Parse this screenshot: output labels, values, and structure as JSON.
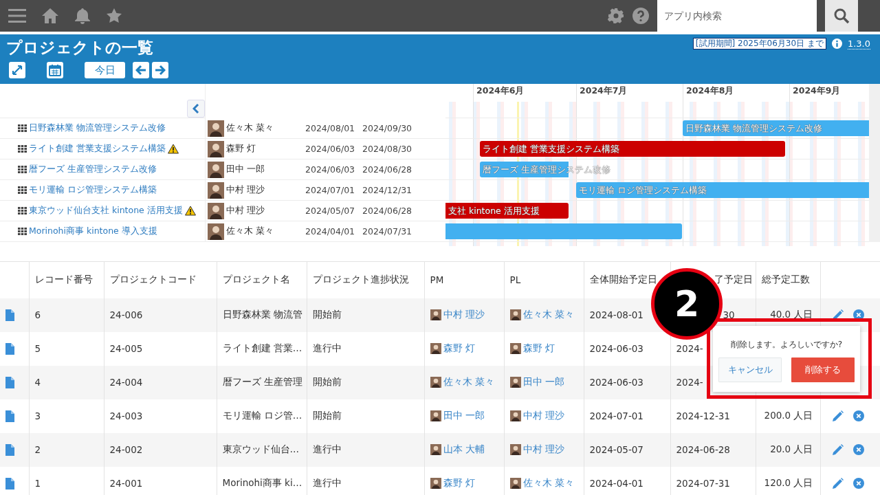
{
  "topbar": {
    "search": {
      "placeholder": "アプリ内検索"
    }
  },
  "header": {
    "title": "プロジェクトの一覧",
    "trial": "[試用期間] 2025年06月30日 まで",
    "version": "1.3.0",
    "today_button": "今日"
  },
  "gantt": {
    "months": [
      "2024年6月",
      "2024年7月",
      "2024年8月",
      "2024年9月"
    ],
    "rows": [
      {
        "name": "日野森林業 物流管理システム改修",
        "warning": false,
        "person": "佐々木 菜々",
        "start": "2024/08/01",
        "end": "2024/09/30",
        "bar": {
          "label": "日野森林業 物流管理システム改修",
          "color": "#42b0f0"
        }
      },
      {
        "name": "ライト創建 営業支援システム構築",
        "warning": true,
        "person": "森野 灯",
        "start": "2024/06/03",
        "end": "2024/08/30",
        "bar": {
          "label": "ライト創建 営業支援システム構築",
          "color": "#cc0000"
        }
      },
      {
        "name": "暦フーズ 生産管理システム改修",
        "warning": false,
        "person": "田中 一郎",
        "start": "2024/06/03",
        "end": "2024/06/28",
        "bar": {
          "label": "暦フーズ 生産管理システム改修",
          "color": "#42b0f0"
        }
      },
      {
        "name": "モリ運輸 ロジ管理システム構築",
        "warning": false,
        "person": "中村 理沙",
        "start": "2024/07/01",
        "end": "2024/12/31",
        "bar": {
          "label": "モリ運輸 ロジ管理システム構築",
          "color": "#42b0f0"
        }
      },
      {
        "name": "東京ウッド仙台支社 kintone 活用支援",
        "warning": true,
        "person": "中村 理沙",
        "start": "2024/05/07",
        "end": "2024/06/28",
        "bar": {
          "label": "支社 kintone 活用支援",
          "color": "#cc0000"
        }
      },
      {
        "name": "Morinohi商事 kintone 導入支援",
        "warning": false,
        "person": "佐々木 菜々",
        "start": "2024/04/01",
        "end": "2024/07/31",
        "bar": {
          "color": "#42b0f0"
        }
      }
    ]
  },
  "table": {
    "columns": [
      "レコード番号",
      "プロジェクトコード",
      "プロジェクト名",
      "プロジェクト進捗状況",
      "PM",
      "PL",
      "全体開始予定日",
      "了予定日",
      "総予定工数"
    ],
    "rows": [
      {
        "no": "6",
        "code": "24-006",
        "name": "日野森林業 物流管",
        "status": "開始前",
        "pm": "中村 理沙",
        "pl": "佐々木 菜々",
        "start": "2024-08-01",
        "end": "30",
        "total": "40.0 人日",
        "actions": true
      },
      {
        "no": "5",
        "code": "24-005",
        "name": "ライト創建 営業…",
        "status": "進行中",
        "pm": "森野 灯",
        "pl": "森野 灯",
        "start": "2024-06-03",
        "end": "2024-",
        "total": "",
        "actions": false
      },
      {
        "no": "4",
        "code": "24-004",
        "name": "暦フーズ 生産管理",
        "status": "開始前",
        "pm": "佐々木 菜々",
        "pl": "田中 一郎",
        "start": "2024-06-03",
        "end": "2024-",
        "total": "",
        "actions": false
      },
      {
        "no": "3",
        "code": "24-003",
        "name": "モリ運輸 ロジ管…",
        "status": "開始前",
        "pm": "田中 一郎",
        "pl": "中村 理沙",
        "start": "2024-07-01",
        "end": "2024-12-31",
        "total": "200.0 人日",
        "actions": true
      },
      {
        "no": "2",
        "code": "24-002",
        "name": "東京ウッド仙台…",
        "status": "進行中",
        "pm": "山本 大輔",
        "pl": "中村 理沙",
        "start": "2024-05-07",
        "end": "2024-06-28",
        "total": "20.0 人日",
        "actions": true
      },
      {
        "no": "1",
        "code": "24-001",
        "name": "Morinohi商事 ki…",
        "status": "進行中",
        "pm": "森野 灯",
        "pl": "佐々木 菜々",
        "start": "2024-04-01",
        "end": "2024-07-31",
        "total": "120.0 人日",
        "actions": true
      }
    ]
  },
  "popup": {
    "message": "削除します。よろしいですか?",
    "cancel": "キャンセル",
    "confirm": "削除する"
  },
  "step_marker": "2"
}
